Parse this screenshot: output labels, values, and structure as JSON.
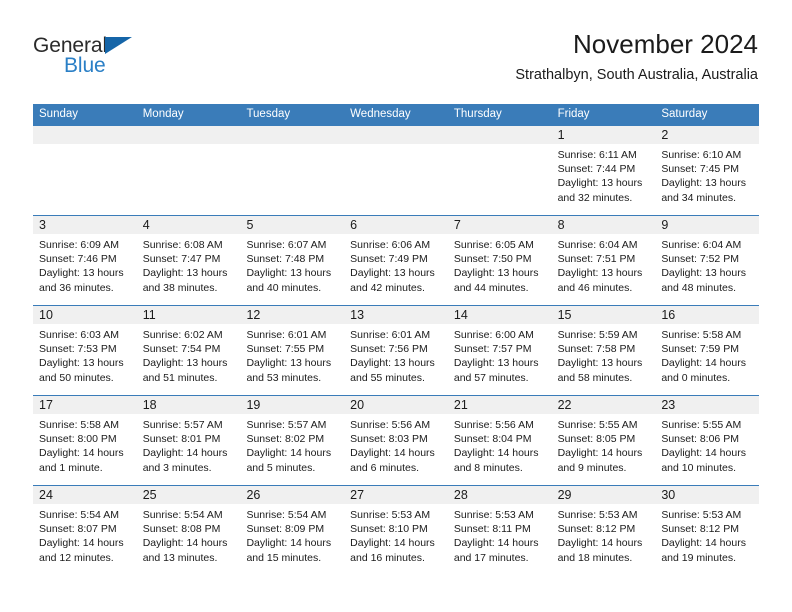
{
  "brand": {
    "name_dark": "General",
    "name_blue": "Blue",
    "accent_blue": "#2a7fc6",
    "triangle_blue": "#1565a8"
  },
  "header": {
    "title": "November 2024",
    "location": "Strathalbyn, South Australia, Australia"
  },
  "calendar": {
    "header_bg": "#3a7cb9",
    "daynum_band_bg": "#f0f0f0",
    "weekdays": [
      "Sunday",
      "Monday",
      "Tuesday",
      "Wednesday",
      "Thursday",
      "Friday",
      "Saturday"
    ],
    "weeks": [
      [
        {
          "day": ""
        },
        {
          "day": ""
        },
        {
          "day": ""
        },
        {
          "day": ""
        },
        {
          "day": ""
        },
        {
          "day": "1",
          "sunrise": "Sunrise: 6:11 AM",
          "sunset": "Sunset: 7:44 PM",
          "daylight_1": "Daylight: 13 hours",
          "daylight_2": "and 32 minutes."
        },
        {
          "day": "2",
          "sunrise": "Sunrise: 6:10 AM",
          "sunset": "Sunset: 7:45 PM",
          "daylight_1": "Daylight: 13 hours",
          "daylight_2": "and 34 minutes."
        }
      ],
      [
        {
          "day": "3",
          "sunrise": "Sunrise: 6:09 AM",
          "sunset": "Sunset: 7:46 PM",
          "daylight_1": "Daylight: 13 hours",
          "daylight_2": "and 36 minutes."
        },
        {
          "day": "4",
          "sunrise": "Sunrise: 6:08 AM",
          "sunset": "Sunset: 7:47 PM",
          "daylight_1": "Daylight: 13 hours",
          "daylight_2": "and 38 minutes."
        },
        {
          "day": "5",
          "sunrise": "Sunrise: 6:07 AM",
          "sunset": "Sunset: 7:48 PM",
          "daylight_1": "Daylight: 13 hours",
          "daylight_2": "and 40 minutes."
        },
        {
          "day": "6",
          "sunrise": "Sunrise: 6:06 AM",
          "sunset": "Sunset: 7:49 PM",
          "daylight_1": "Daylight: 13 hours",
          "daylight_2": "and 42 minutes."
        },
        {
          "day": "7",
          "sunrise": "Sunrise: 6:05 AM",
          "sunset": "Sunset: 7:50 PM",
          "daylight_1": "Daylight: 13 hours",
          "daylight_2": "and 44 minutes."
        },
        {
          "day": "8",
          "sunrise": "Sunrise: 6:04 AM",
          "sunset": "Sunset: 7:51 PM",
          "daylight_1": "Daylight: 13 hours",
          "daylight_2": "and 46 minutes."
        },
        {
          "day": "9",
          "sunrise": "Sunrise: 6:04 AM",
          "sunset": "Sunset: 7:52 PM",
          "daylight_1": "Daylight: 13 hours",
          "daylight_2": "and 48 minutes."
        }
      ],
      [
        {
          "day": "10",
          "sunrise": "Sunrise: 6:03 AM",
          "sunset": "Sunset: 7:53 PM",
          "daylight_1": "Daylight: 13 hours",
          "daylight_2": "and 50 minutes."
        },
        {
          "day": "11",
          "sunrise": "Sunrise: 6:02 AM",
          "sunset": "Sunset: 7:54 PM",
          "daylight_1": "Daylight: 13 hours",
          "daylight_2": "and 51 minutes."
        },
        {
          "day": "12",
          "sunrise": "Sunrise: 6:01 AM",
          "sunset": "Sunset: 7:55 PM",
          "daylight_1": "Daylight: 13 hours",
          "daylight_2": "and 53 minutes."
        },
        {
          "day": "13",
          "sunrise": "Sunrise: 6:01 AM",
          "sunset": "Sunset: 7:56 PM",
          "daylight_1": "Daylight: 13 hours",
          "daylight_2": "and 55 minutes."
        },
        {
          "day": "14",
          "sunrise": "Sunrise: 6:00 AM",
          "sunset": "Sunset: 7:57 PM",
          "daylight_1": "Daylight: 13 hours",
          "daylight_2": "and 57 minutes."
        },
        {
          "day": "15",
          "sunrise": "Sunrise: 5:59 AM",
          "sunset": "Sunset: 7:58 PM",
          "daylight_1": "Daylight: 13 hours",
          "daylight_2": "and 58 minutes."
        },
        {
          "day": "16",
          "sunrise": "Sunrise: 5:58 AM",
          "sunset": "Sunset: 7:59 PM",
          "daylight_1": "Daylight: 14 hours",
          "daylight_2": "and 0 minutes."
        }
      ],
      [
        {
          "day": "17",
          "sunrise": "Sunrise: 5:58 AM",
          "sunset": "Sunset: 8:00 PM",
          "daylight_1": "Daylight: 14 hours",
          "daylight_2": "and 1 minute."
        },
        {
          "day": "18",
          "sunrise": "Sunrise: 5:57 AM",
          "sunset": "Sunset: 8:01 PM",
          "daylight_1": "Daylight: 14 hours",
          "daylight_2": "and 3 minutes."
        },
        {
          "day": "19",
          "sunrise": "Sunrise: 5:57 AM",
          "sunset": "Sunset: 8:02 PM",
          "daylight_1": "Daylight: 14 hours",
          "daylight_2": "and 5 minutes."
        },
        {
          "day": "20",
          "sunrise": "Sunrise: 5:56 AM",
          "sunset": "Sunset: 8:03 PM",
          "daylight_1": "Daylight: 14 hours",
          "daylight_2": "and 6 minutes."
        },
        {
          "day": "21",
          "sunrise": "Sunrise: 5:56 AM",
          "sunset": "Sunset: 8:04 PM",
          "daylight_1": "Daylight: 14 hours",
          "daylight_2": "and 8 minutes."
        },
        {
          "day": "22",
          "sunrise": "Sunrise: 5:55 AM",
          "sunset": "Sunset: 8:05 PM",
          "daylight_1": "Daylight: 14 hours",
          "daylight_2": "and 9 minutes."
        },
        {
          "day": "23",
          "sunrise": "Sunrise: 5:55 AM",
          "sunset": "Sunset: 8:06 PM",
          "daylight_1": "Daylight: 14 hours",
          "daylight_2": "and 10 minutes."
        }
      ],
      [
        {
          "day": "24",
          "sunrise": "Sunrise: 5:54 AM",
          "sunset": "Sunset: 8:07 PM",
          "daylight_1": "Daylight: 14 hours",
          "daylight_2": "and 12 minutes."
        },
        {
          "day": "25",
          "sunrise": "Sunrise: 5:54 AM",
          "sunset": "Sunset: 8:08 PM",
          "daylight_1": "Daylight: 14 hours",
          "daylight_2": "and 13 minutes."
        },
        {
          "day": "26",
          "sunrise": "Sunrise: 5:54 AM",
          "sunset": "Sunset: 8:09 PM",
          "daylight_1": "Daylight: 14 hours",
          "daylight_2": "and 15 minutes."
        },
        {
          "day": "27",
          "sunrise": "Sunrise: 5:53 AM",
          "sunset": "Sunset: 8:10 PM",
          "daylight_1": "Daylight: 14 hours",
          "daylight_2": "and 16 minutes."
        },
        {
          "day": "28",
          "sunrise": "Sunrise: 5:53 AM",
          "sunset": "Sunset: 8:11 PM",
          "daylight_1": "Daylight: 14 hours",
          "daylight_2": "and 17 minutes."
        },
        {
          "day": "29",
          "sunrise": "Sunrise: 5:53 AM",
          "sunset": "Sunset: 8:12 PM",
          "daylight_1": "Daylight: 14 hours",
          "daylight_2": "and 18 minutes."
        },
        {
          "day": "30",
          "sunrise": "Sunrise: 5:53 AM",
          "sunset": "Sunset: 8:12 PM",
          "daylight_1": "Daylight: 14 hours",
          "daylight_2": "and 19 minutes."
        }
      ]
    ]
  }
}
